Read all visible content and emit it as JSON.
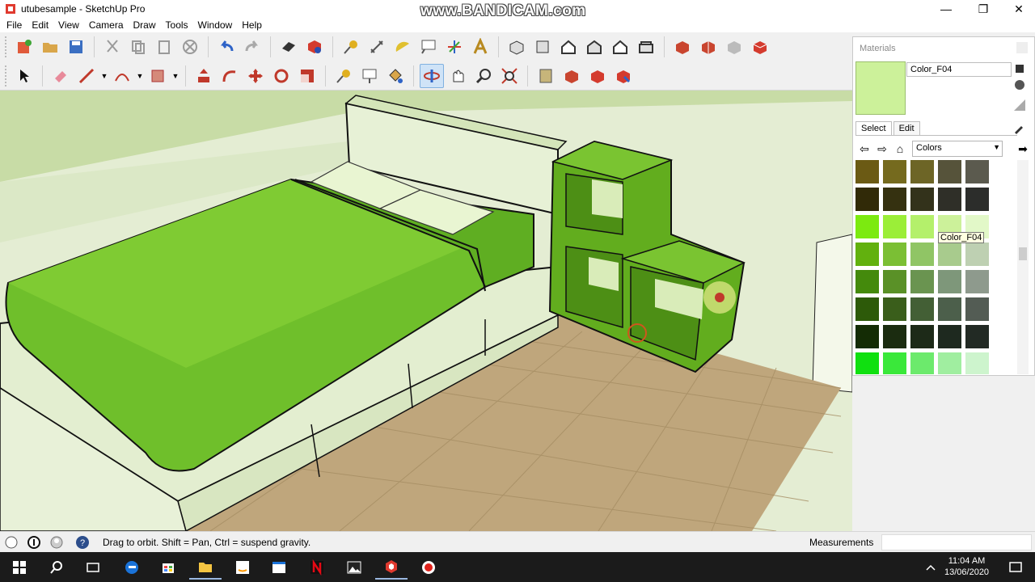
{
  "window": {
    "title": "utubesample - SketchUp Pro",
    "watermark": "www.BANDICAM.com",
    "controls": {
      "minimize": "—",
      "maximize": "❐",
      "close": "✕"
    }
  },
  "menu": [
    "File",
    "Edit",
    "View",
    "Camera",
    "Draw",
    "Tools",
    "Window",
    "Help"
  ],
  "toolbar1_icons": [
    "new-model-icon",
    "open-icon",
    "save-icon",
    "cut-icon",
    "copy-icon",
    "paste-icon",
    "erase-icon",
    "undo-icon",
    "redo-icon",
    "print-icon",
    "model-info-icon",
    "tape-measure-icon",
    "dimension-icon",
    "protractor-icon",
    "text-icon",
    "axes-icon",
    "3d-text-icon",
    "iso-view-icon",
    "top-view-icon",
    "front-view-icon",
    "right-view-icon",
    "back-view-icon",
    "left-view-icon",
    "warehouse-icon",
    "share-model-icon",
    "components-icon",
    "extension-warehouse-icon"
  ],
  "toolbar2_icons": [
    "select-icon",
    "eraser-icon",
    "line-icon",
    "arc-icon",
    "rectangle-icon",
    "push-pull-icon",
    "follow-me-icon",
    "move-icon",
    "rotate-icon",
    "scale-icon",
    "offset-icon",
    "tape-measure-icon",
    "text-icon",
    "paint-bucket-icon",
    "orbit-icon",
    "pan-icon",
    "zoom-icon",
    "zoom-extents-icon",
    "previous-view-icon",
    "warehouse-icon",
    "components-icon",
    "extension-icon"
  ],
  "materials": {
    "title": "Materials",
    "selected_name": "Color_F04",
    "selected_color": "#ccf19a",
    "tabs": [
      "Select",
      "Edit"
    ],
    "collection": "Colors",
    "tooltip": "Color_F04",
    "swatches": [
      [
        "#6b5a14",
        "#756a1e",
        "#6d6526",
        "#56533a",
        "#5b5a4e"
      ],
      [
        "#312a08",
        "#353110",
        "#33321b",
        "#2f2f28",
        "#2c2d2b"
      ],
      [
        "#7cea10",
        "#9bee38",
        "#b4f06b",
        "#ccf19a",
        "#e2f8c8"
      ],
      [
        "#62b10e",
        "#7bbf34",
        "#90c565",
        "#a8cb8d",
        "#bed0b2"
      ],
      [
        "#448a0c",
        "#5a9127",
        "#6a9450",
        "#7e977a",
        "#8e9a8d"
      ],
      [
        "#2d5a09",
        "#3a5e1b",
        "#435f35",
        "#4c5f4b",
        "#535c54"
      ],
      [
        "#142c05",
        "#1b2c10",
        "#1d2a18",
        "#1e291f",
        "#222a24"
      ],
      [
        "#10e010",
        "#3ae83a",
        "#6cea6c",
        "#a0eea0",
        "#cdf4cd"
      ],
      [
        "#0fb40f",
        "#2fc02f",
        "#54c654",
        "#82ca82",
        "#aad1aa"
      ]
    ]
  },
  "status": {
    "hint": "Drag to orbit. Shift = Pan, Ctrl = suspend gravity.",
    "measurements_label": "Measurements",
    "measurements_value": ""
  },
  "taskbar": {
    "apps": [
      "windows-start-icon",
      "search-icon",
      "task-view-icon",
      "edge-icon",
      "store-icon",
      "file-explorer-icon",
      "amazon-icon",
      "window-app-icon",
      "netflix-icon",
      "photos-icon",
      "sketchup-icon",
      "record-icon"
    ],
    "time": "11:04 AM",
    "date": "13/06/2020"
  }
}
